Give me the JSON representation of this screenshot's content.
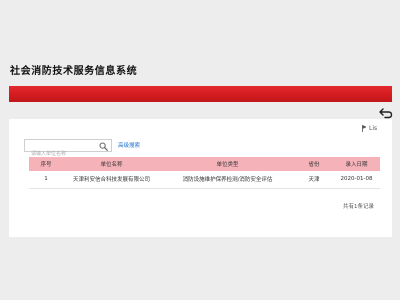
{
  "header": {
    "title": "社会消防技术服务信息系统"
  },
  "toolbar": {
    "back_icon": "back-arrow-icon"
  },
  "card": {
    "tools_label": "Lis"
  },
  "search": {
    "placeholder": "请输入单位名称",
    "value": "",
    "advanced_label": "高级搜索"
  },
  "table": {
    "columns": [
      "序号",
      "单位名称",
      "单位类型",
      "省份",
      "录入日期"
    ],
    "rows": [
      [
        "1",
        "天津利安信合科技发展有限公司",
        "消防设施维护保养检测/消防安全评估",
        "天津",
        "2020-01-08"
      ]
    ]
  },
  "pager": {
    "summary": "共有1条记录"
  },
  "colors": {
    "brand_red": "#d41c20",
    "table_header": "#f5b3b9",
    "link_blue": "#1e6fd0"
  }
}
